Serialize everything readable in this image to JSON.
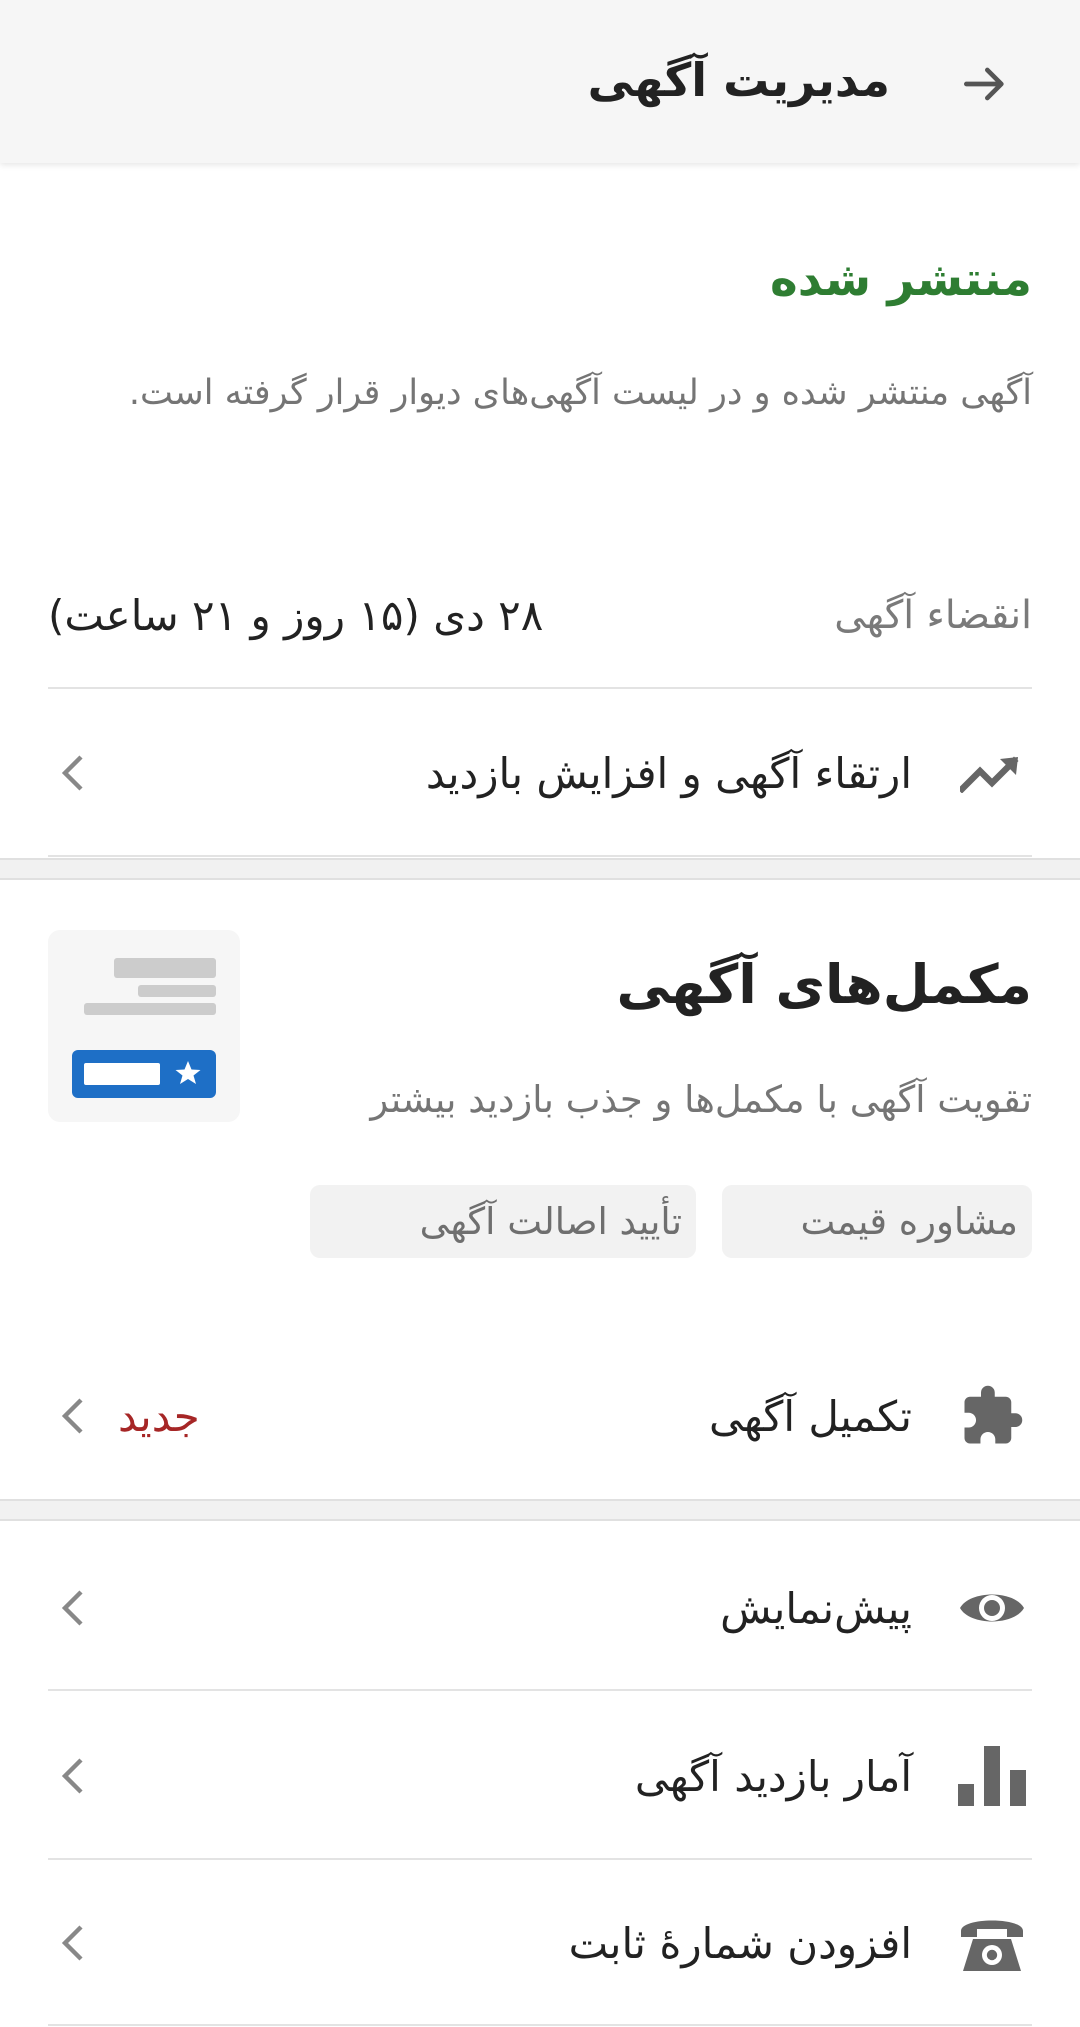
{
  "header": {
    "title": "مدیریت آگهی",
    "back_icon": "arrow-right-icon"
  },
  "status": {
    "title": "منتشر شده",
    "description": "آگهی منتشر شده و در لیست آگهی‌های دیوار قرار گرفته است.",
    "color": "#2e7d32"
  },
  "expiry": {
    "label": "انقضاء آگهی",
    "value": "۲۸ دی (۱۵ روز و ۲۱ ساعت)"
  },
  "promote": {
    "label": "ارتقاء آگهی و افزایش بازدید",
    "icon": "trending-up-icon"
  },
  "addons": {
    "title": "مکمل‌های آگهی",
    "description": "تقویت آگهی با مکمل‌ها و جذب بازدید بیشتر",
    "chips": [
      "مشاوره قیمت",
      "تأیید اصالت آگهی"
    ],
    "illustration_accent": "#1e6fc6"
  },
  "complete": {
    "label": "تکمیل آگهی",
    "badge": "جدید",
    "badge_color": "#a62626",
    "icon": "puzzle-icon"
  },
  "menu": [
    {
      "label": "پیش‌نمایش",
      "icon": "eye-icon"
    },
    {
      "label": "آمار بازدید آگهی",
      "icon": "bar-chart-icon"
    },
    {
      "label": "افزودن شمارهٔ ثابت",
      "icon": "telephone-icon"
    }
  ]
}
